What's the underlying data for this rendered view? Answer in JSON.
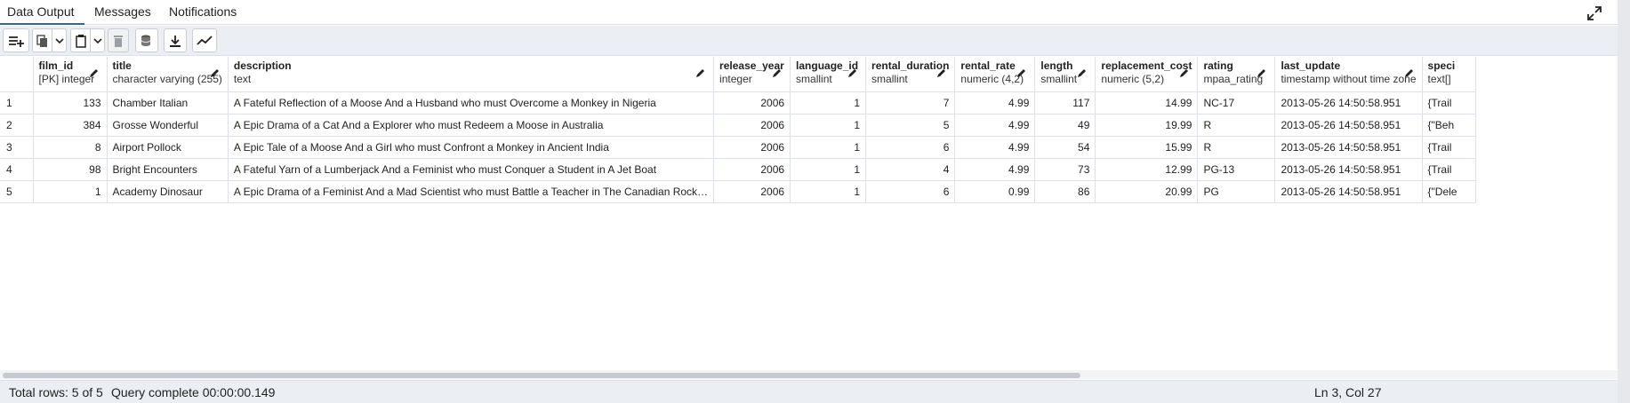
{
  "tabs": [
    {
      "label": "Data Output",
      "active": true
    },
    {
      "label": "Messages",
      "active": false
    },
    {
      "label": "Notifications",
      "active": false
    }
  ],
  "toolbar": {
    "buttons": [
      "add-row-icon",
      "copy-icon",
      "dropdown-icon",
      "paste-icon",
      "dropdown-icon",
      "delete-icon",
      "save-data-icon",
      "download-icon",
      "graph-icon"
    ]
  },
  "columns": [
    {
      "name": "film_id",
      "type": "[PK] integer"
    },
    {
      "name": "title",
      "type": "character varying (255)"
    },
    {
      "name": "description",
      "type": "text"
    },
    {
      "name": "release_year",
      "type": "integer"
    },
    {
      "name": "language_id",
      "type": "smallint"
    },
    {
      "name": "rental_duration",
      "type": "smallint"
    },
    {
      "name": "rental_rate",
      "type": "numeric (4,2)"
    },
    {
      "name": "length",
      "type": "smallint"
    },
    {
      "name": "replacement_cost",
      "type": "numeric (5,2)"
    },
    {
      "name": "rating",
      "type": "mpaa_rating"
    },
    {
      "name": "last_update",
      "type": "timestamp without time zone"
    },
    {
      "name": "speci",
      "type": "text[]"
    }
  ],
  "rows": [
    {
      "row": "1",
      "film_id": "133",
      "title": "Chamber Italian",
      "description": "A Fateful Reflection of a Moose And a Husband who must Overcome a Monkey in Nigeria",
      "release_year": "2006",
      "language_id": "1",
      "rental_duration": "7",
      "rental_rate": "4.99",
      "length": "117",
      "replacement_cost": "14.99",
      "rating": "NC-17",
      "last_update": "2013-05-26 14:50:58.951",
      "special": "{Trail"
    },
    {
      "row": "2",
      "film_id": "384",
      "title": "Grosse Wonderful",
      "description": "A Epic Drama of a Cat And a Explorer who must Redeem a Moose in Australia",
      "release_year": "2006",
      "language_id": "1",
      "rental_duration": "5",
      "rental_rate": "4.99",
      "length": "49",
      "replacement_cost": "19.99",
      "rating": "R",
      "last_update": "2013-05-26 14:50:58.951",
      "special": "{\"Beh"
    },
    {
      "row": "3",
      "film_id": "8",
      "title": "Airport Pollock",
      "description": "A Epic Tale of a Moose And a Girl who must Confront a Monkey in Ancient India",
      "release_year": "2006",
      "language_id": "1",
      "rental_duration": "6",
      "rental_rate": "4.99",
      "length": "54",
      "replacement_cost": "15.99",
      "rating": "R",
      "last_update": "2013-05-26 14:50:58.951",
      "special": "{Trail"
    },
    {
      "row": "4",
      "film_id": "98",
      "title": "Bright Encounters",
      "description": "A Fateful Yarn of a Lumberjack And a Feminist who must Conquer a Student in A Jet Boat",
      "release_year": "2006",
      "language_id": "1",
      "rental_duration": "4",
      "rental_rate": "4.99",
      "length": "73",
      "replacement_cost": "12.99",
      "rating": "PG-13",
      "last_update": "2013-05-26 14:50:58.951",
      "special": "{Trail"
    },
    {
      "row": "5",
      "film_id": "1",
      "title": "Academy Dinosaur",
      "description": "A Epic Drama of a Feminist And a Mad Scientist who must Battle a Teacher in The Canadian Rock…",
      "release_year": "2006",
      "language_id": "1",
      "rental_duration": "6",
      "rental_rate": "0.99",
      "length": "86",
      "replacement_cost": "20.99",
      "rating": "PG",
      "last_update": "2013-05-26 14:50:58.951",
      "special": "{\"Dele"
    }
  ],
  "status": {
    "total_rows": "Total rows: 5 of 5",
    "query": "Query complete 00:00:00.149",
    "cursor": "Ln 3, Col 27"
  }
}
